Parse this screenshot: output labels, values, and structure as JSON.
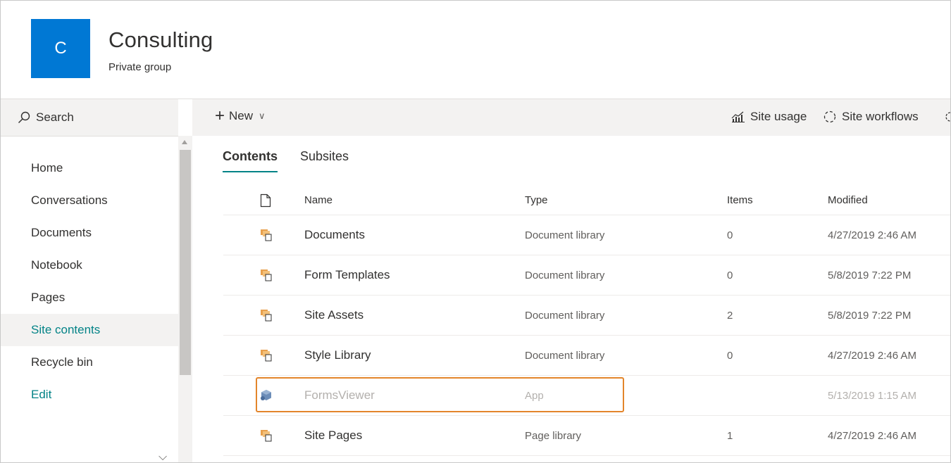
{
  "header": {
    "logo_letter": "C",
    "title": "Consulting",
    "subtitle": "Private group",
    "logo_color": "#0078d4"
  },
  "leftnav": {
    "search_label": "Search",
    "items": [
      {
        "label": "Home"
      },
      {
        "label": "Conversations"
      },
      {
        "label": "Documents"
      },
      {
        "label": "Notebook"
      },
      {
        "label": "Pages"
      },
      {
        "label": "Site contents",
        "active": true
      },
      {
        "label": "Recycle bin"
      },
      {
        "label": "Edit"
      }
    ]
  },
  "commandbar": {
    "new_label": "New",
    "site_usage": "Site usage",
    "site_workflows": "Site workflows"
  },
  "tabs": [
    {
      "label": "Contents",
      "active": true
    },
    {
      "label": "Subsites"
    }
  ],
  "table": {
    "columns": {
      "name": "Name",
      "type": "Type",
      "items": "Items",
      "modified": "Modified"
    },
    "rows": [
      {
        "icon": "document-library-icon",
        "name": "Documents",
        "type": "Document library",
        "items": "0",
        "modified": "4/27/2019 2:46 AM"
      },
      {
        "icon": "document-library-icon",
        "name": "Form Templates",
        "type": "Document library",
        "items": "0",
        "modified": "5/8/2019 7:22 PM"
      },
      {
        "icon": "document-library-icon",
        "name": "Site Assets",
        "type": "Document library",
        "items": "2",
        "modified": "5/8/2019 7:22 PM"
      },
      {
        "icon": "document-library-icon",
        "name": "Style Library",
        "type": "Document library",
        "items": "0",
        "modified": "4/27/2019 2:46 AM"
      },
      {
        "icon": "app-icon",
        "name": "FormsViewer",
        "type": "App",
        "items": "",
        "modified": "5/13/2019 1:15 AM",
        "dimmed": true,
        "highlighted": true
      },
      {
        "icon": "document-library-icon",
        "name": "Site Pages",
        "type": "Page library",
        "items": "1",
        "modified": "4/27/2019 2:46 AM"
      }
    ]
  },
  "colors": {
    "accent": "#038387",
    "highlight_border": "#e3852b",
    "library_icon": "#e8a04c"
  }
}
